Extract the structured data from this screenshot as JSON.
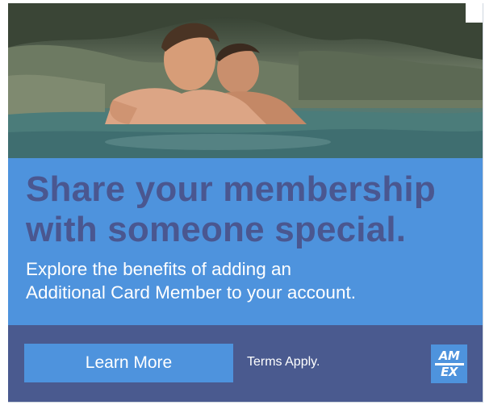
{
  "headline": {
    "line1": "Share your membership",
    "line2": "with someone special."
  },
  "subhead": {
    "line1": "Explore the benefits of adding an",
    "line2": "Additional Card Member to your account."
  },
  "footer": {
    "cta_label": "Learn More",
    "terms": "Terms Apply.",
    "logo": {
      "line1": "AM",
      "line2": "EX"
    }
  },
  "photo": {
    "subject": "two-men-swimming-photo"
  },
  "colors": {
    "accent_blue": "#4e93dd",
    "headline_text": "#4a5790",
    "footer_bg": "#4a5a8f"
  }
}
